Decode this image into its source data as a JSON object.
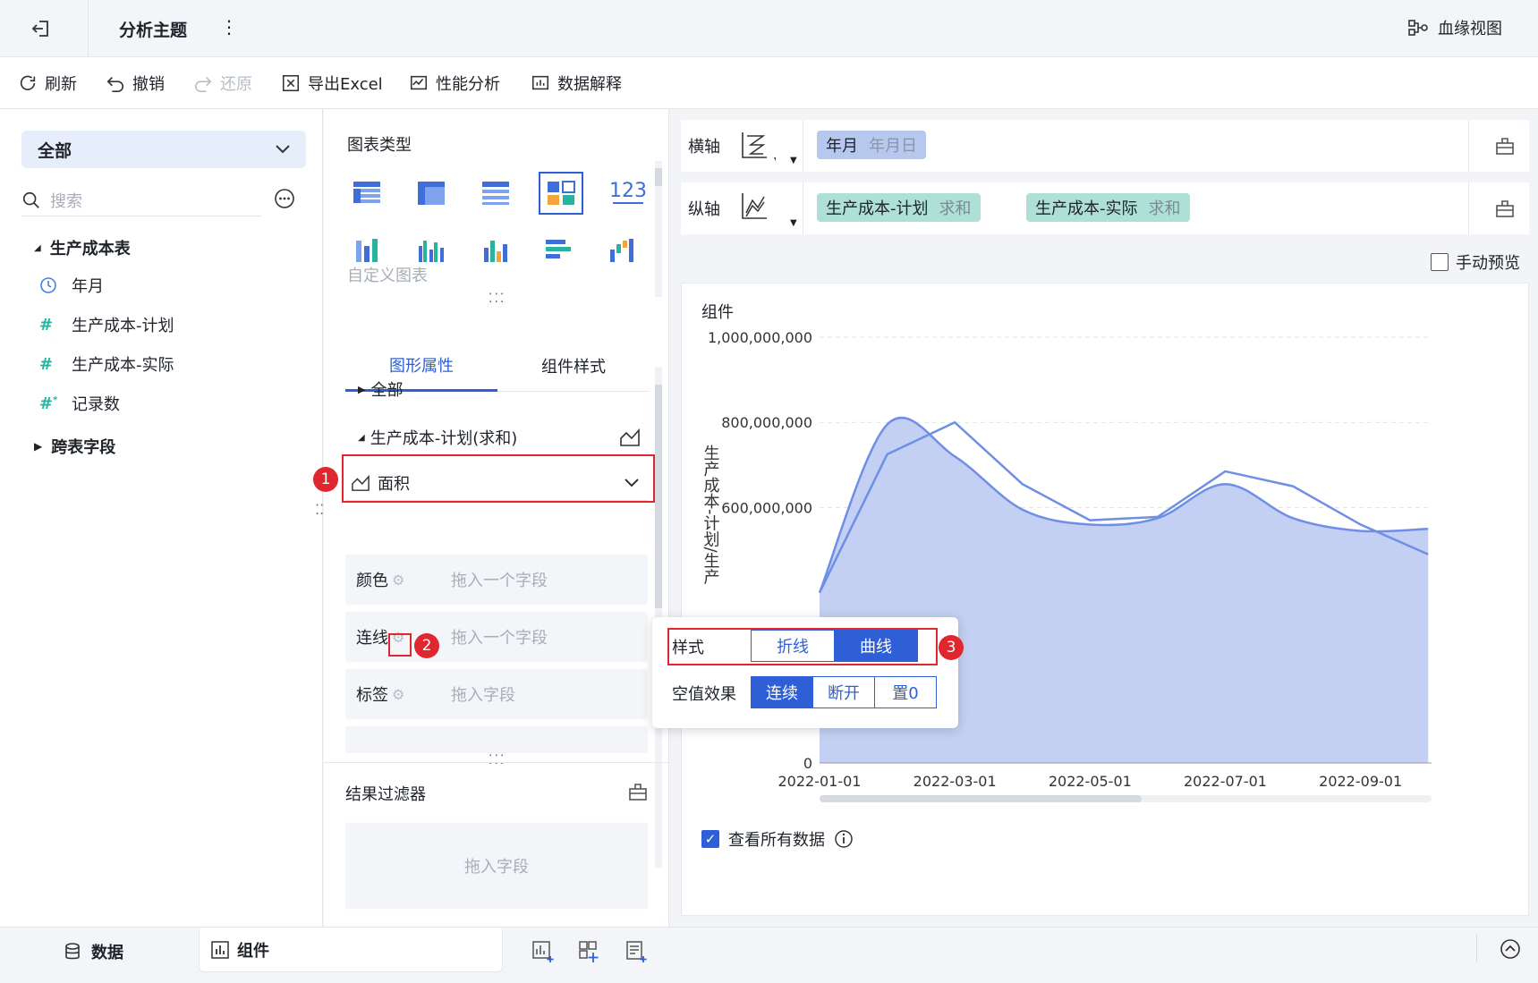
{
  "header": {
    "title": "分析主题",
    "lineage_label": "血缘视图"
  },
  "toolbar": {
    "refresh": "刷新",
    "undo": "撤销",
    "redo": "还原",
    "export_excel": "导出Excel",
    "performance": "性能分析",
    "data_explain": "数据解释"
  },
  "left": {
    "dropdown": "全部",
    "search_placeholder": "搜索",
    "table_name": "生产成本表",
    "fields": [
      "年月",
      "生产成本-计划",
      "生产成本-实际",
      "记录数"
    ],
    "cross_table": "跨表字段"
  },
  "middle": {
    "chart_type_title": "图表类型",
    "number_icon": "123",
    "custom_chart": "自定义图表",
    "tabs": [
      "图形属性",
      "组件样式"
    ],
    "all_label": "全部",
    "series_label": "生产成本-计划(求和)",
    "graph_type": "面积",
    "slots": [
      {
        "label": "颜色",
        "hint": "拖入一个字段"
      },
      {
        "label": "连线",
        "hint": "拖入一个字段"
      },
      {
        "label": "标签",
        "hint": "拖入字段"
      }
    ],
    "filter_title": "结果过滤器",
    "filter_hint": "拖入字段"
  },
  "axes": {
    "x_label": "横轴",
    "x_field": "年月",
    "x_field_sub": "年月日",
    "y_label": "纵轴",
    "y_fields": [
      {
        "name": "生产成本-计划",
        "agg": "求和"
      },
      {
        "name": "生产成本-实际",
        "agg": "求和"
      }
    ],
    "manual_preview": "手动预览"
  },
  "popup": {
    "style_label": "样式",
    "style_options": [
      "折线",
      "曲线"
    ],
    "style_selected": "曲线",
    "null_label": "空值效果",
    "null_options": [
      "连续",
      "断开",
      "置0"
    ],
    "null_selected": "连续"
  },
  "badges": [
    "1",
    "2",
    "3"
  ],
  "chart_card": {
    "title": "组件",
    "view_all": "查看所有数据"
  },
  "chart_data": {
    "type": "area",
    "ylabel_visible": "生产成本-计划/生产",
    "yticks": [
      "1,000,000,000",
      "800,000,000",
      "600,000,000",
      "0"
    ],
    "xticks": [
      "2022-01-01",
      "2022-03-01",
      "2022-05-01",
      "2022-07-01",
      "2022-09-01"
    ],
    "ylim": [
      0,
      1000000000
    ],
    "x": [
      "2022-01-01",
      "2022-02-01",
      "2022-03-01",
      "2022-04-01",
      "2022-05-01",
      "2022-06-01",
      "2022-07-01",
      "2022-08-01",
      "2022-09-01",
      "2022-10-01"
    ],
    "series": [
      {
        "values": [
          400000000,
          725000000,
          800000000,
          655000000,
          570000000,
          578000000,
          685000000,
          650000000,
          560000000,
          490000000
        ]
      },
      {
        "values": [
          400000000,
          795000000,
          720000000,
          595000000,
          560000000,
          575000000,
          655000000,
          575000000,
          545000000,
          550000000
        ]
      }
    ],
    "colors": {
      "fill": "#c3d0f3",
      "line": "#6f8fe6"
    }
  },
  "bottom": {
    "data_tab": "数据",
    "component_tab": "组件"
  }
}
